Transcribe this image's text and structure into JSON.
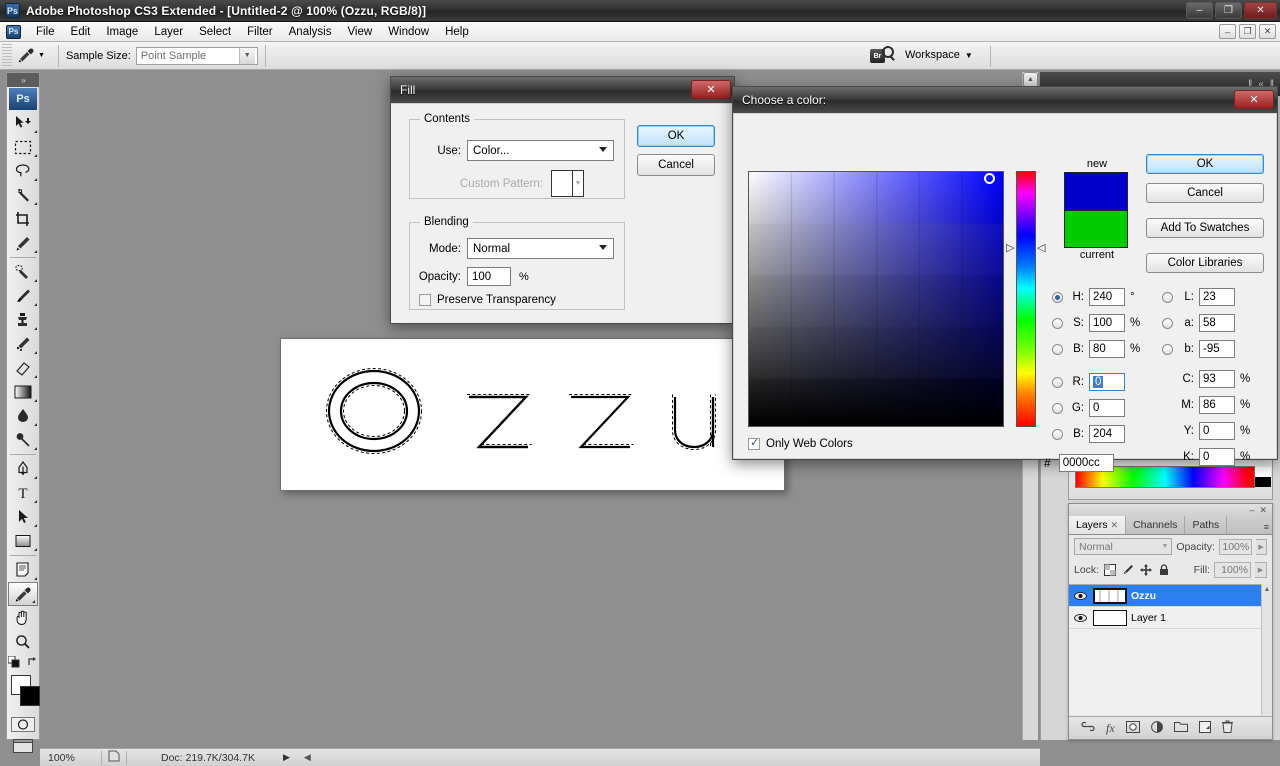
{
  "window": {
    "title": "Adobe Photoshop CS3 Extended - [Untitled-2 @ 100% (Ozzu, RGB/8)]",
    "app_icon": "Ps",
    "minimize": "–",
    "maximize": "❐",
    "close": "✕"
  },
  "menubar": {
    "icon": "Ps",
    "items": [
      "File",
      "Edit",
      "Image",
      "Layer",
      "Select",
      "Filter",
      "Analysis",
      "View",
      "Window",
      "Help"
    ],
    "doc_minimize": "–",
    "doc_restore": "❐",
    "doc_close": "✕"
  },
  "options_bar": {
    "tool_icon": "eyedropper-icon",
    "sample_size_label": "Sample Size:",
    "sample_size_value": "Point Sample",
    "bridge_icon_label": "Br",
    "workspace_label": "Workspace",
    "workspace_caret": "▼"
  },
  "toolbox": {
    "expand": "»",
    "logo": "Ps",
    "tools": [
      {
        "name": "move-tool",
        "glyph": "⬆"
      },
      {
        "name": "marquee-tool",
        "glyph": "⬚"
      },
      {
        "name": "lasso-tool",
        "glyph": "℘"
      },
      {
        "name": "magic-wand-tool",
        "glyph": "✦"
      },
      {
        "name": "crop-tool",
        "glyph": "⋈"
      },
      {
        "name": "slice-tool",
        "glyph": "╱"
      },
      {
        "name": "healing-brush-tool",
        "glyph": "✐"
      },
      {
        "name": "brush-tool",
        "glyph": "✎"
      },
      {
        "name": "clone-stamp-tool",
        "glyph": "⚓"
      },
      {
        "name": "history-brush-tool",
        "glyph": "✒"
      },
      {
        "name": "eraser-tool",
        "glyph": "▱"
      },
      {
        "name": "gradient-tool",
        "glyph": "▤"
      },
      {
        "name": "blur-tool",
        "glyph": "●"
      },
      {
        "name": "dodge-tool",
        "glyph": "⚲"
      },
      {
        "name": "pen-tool",
        "glyph": "✒"
      },
      {
        "name": "type-tool",
        "glyph": "T"
      },
      {
        "name": "path-selection-tool",
        "glyph": "➤"
      },
      {
        "name": "shape-tool",
        "glyph": "■"
      },
      {
        "name": "notes-tool",
        "glyph": "☰"
      },
      {
        "name": "eyedropper-tool",
        "glyph": "✐"
      },
      {
        "name": "hand-tool",
        "glyph": "✋"
      },
      {
        "name": "zoom-tool",
        "glyph": "⌕"
      }
    ],
    "foreground_color": "#ffffff",
    "background_color": "#000000",
    "quickmask": "◯",
    "screenmode": "▣"
  },
  "canvas": {
    "document_text": "Ozzu",
    "background": "#ffffff"
  },
  "fill_dialog": {
    "title": "Fill",
    "close": "✕",
    "contents_group": "Contents",
    "use_label": "Use:",
    "use_value": "Color...",
    "custom_pattern_label": "Custom Pattern:",
    "blending_group": "Blending",
    "mode_label": "Mode:",
    "mode_value": "Normal",
    "opacity_label": "Opacity:",
    "opacity_value": "100",
    "opacity_unit": "%",
    "preserve_label": "Preserve Transparency",
    "ok": "OK",
    "cancel": "Cancel"
  },
  "color_dialog": {
    "title": "Choose a color:",
    "close": "✕",
    "new_label": "new",
    "current_label": "current",
    "new_color": "#0000cc",
    "current_color": "#00cc00",
    "buttons": [
      "OK",
      "Cancel",
      "Add To Swatches",
      "Color Libraries"
    ],
    "only_web_colors_label": "Only Web Colors",
    "only_web_colors_checked": true,
    "hsb": [
      {
        "label": "H:",
        "value": "240",
        "unit": "°",
        "selected": true
      },
      {
        "label": "S:",
        "value": "100",
        "unit": "%",
        "selected": false
      },
      {
        "label": "B:",
        "value": "80",
        "unit": "%",
        "selected": false
      }
    ],
    "rgb": [
      {
        "label": "R:",
        "value": "0",
        "unit": "",
        "selected": false,
        "focused": true
      },
      {
        "label": "G:",
        "value": "0",
        "unit": "",
        "selected": false,
        "focused": false
      },
      {
        "label": "B:",
        "value": "204",
        "unit": "",
        "selected": false,
        "focused": false
      }
    ],
    "lab": [
      {
        "label": "L:",
        "value": "23",
        "unit": "",
        "selected": false
      },
      {
        "label": "a:",
        "value": "58",
        "unit": "",
        "selected": false
      },
      {
        "label": "b:",
        "value": "-95",
        "unit": "",
        "selected": false
      }
    ],
    "cmyk": [
      {
        "label": "C:",
        "value": "93",
        "unit": "%"
      },
      {
        "label": "M:",
        "value": "86",
        "unit": "%"
      },
      {
        "label": "Y:",
        "value": "0",
        "unit": "%"
      },
      {
        "label": "K:",
        "value": "0",
        "unit": "%"
      }
    ],
    "hex_label": "#",
    "hex_value": "0000cc"
  },
  "layers_panel": {
    "tabs": [
      {
        "label": "Layers",
        "active": true,
        "close": "✕"
      },
      {
        "label": "Channels",
        "active": false
      },
      {
        "label": "Paths",
        "active": false
      }
    ],
    "panel_menu": "≡",
    "minimize": "–",
    "close": "✕",
    "blend_mode": "Normal",
    "opacity_label": "Opacity:",
    "opacity_value": "100%",
    "lock_label": "Lock:",
    "lock_icons": [
      "▦",
      "✐",
      "✛",
      "⚿"
    ],
    "fill_label": "Fill:",
    "fill_value": "100%",
    "layers": [
      {
        "name": "Ozzu",
        "visible": true,
        "selected": true
      },
      {
        "name": "Layer 1",
        "visible": true,
        "selected": false
      }
    ],
    "footer_icons": [
      "⚭",
      "fx",
      "□",
      "◑",
      "▱",
      "❐",
      "☒"
    ]
  },
  "status_bar": {
    "zoom": "100%",
    "doc_info": "Doc: 219.7K/304.7K",
    "arrow": "▶"
  }
}
